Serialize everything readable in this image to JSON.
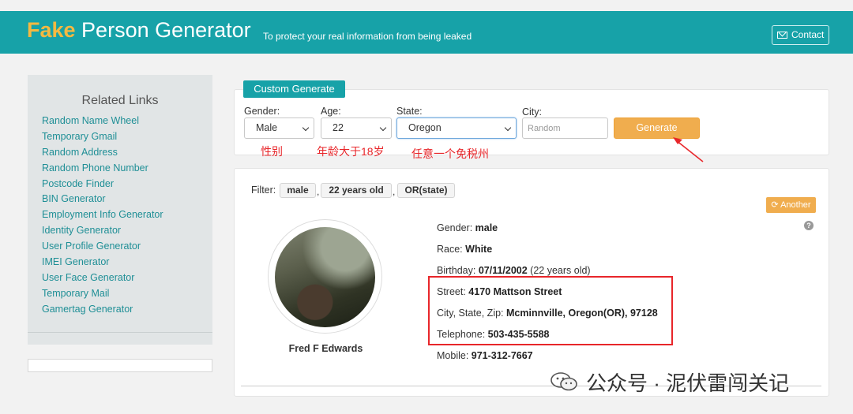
{
  "header": {
    "title_fake": "Fake",
    "title_rest": " Person Generator",
    "tagline": "To protect your real information from being leaked",
    "contact_label": "Contact"
  },
  "sidebar": {
    "heading": "Related Links",
    "items": [
      "Random Name Wheel",
      "Temporary Gmail",
      "Random Address",
      "Random Phone Number",
      "Postcode Finder",
      "BIN Generator",
      "Employment Info Generator",
      "Identity Generator",
      "User Profile Generator",
      "IMEI Generator",
      "User Face Generator",
      "Temporary Mail",
      "Gamertag Generator"
    ]
  },
  "custom": {
    "tab_label": "Custom Generate",
    "gender_label": "Gender:",
    "gender_value": "Male",
    "age_label": "Age:",
    "age_value": "22",
    "state_label": "State:",
    "state_value": "Oregon",
    "city_label": "City:",
    "city_placeholder": "Random",
    "generate_label": "Generate",
    "note_gender": "性别",
    "note_age": "年龄大于18岁",
    "note_state": "任意一个免税州"
  },
  "result": {
    "filter_label": "Filter:",
    "filters": [
      "male",
      "22 years old",
      "OR(state)"
    ],
    "another_label": "Another",
    "name": "Fred F Edwards",
    "fields": [
      {
        "label": "Gender: ",
        "value": "male",
        "suffix": ""
      },
      {
        "label": "Race: ",
        "value": "White",
        "suffix": ""
      },
      {
        "label": "Birthday: ",
        "value": "07/11/2002",
        "suffix": " (22 years old)"
      },
      {
        "label": "Street: ",
        "value": "4170 Mattson Street",
        "suffix": ""
      },
      {
        "label": "City, State, Zip: ",
        "value": "Mcminnville, Oregon(OR), 97128",
        "suffix": ""
      },
      {
        "label": "Telephone: ",
        "value": "503-435-5588",
        "suffix": ""
      },
      {
        "label": "Mobile: ",
        "value": "971-312-7667",
        "suffix": ""
      }
    ]
  },
  "watermark": "公众号 · 泥伏雷闯关记",
  "colors": {
    "brand": "#17a2a8",
    "accent": "#f0ad4e",
    "annotation": "#e8262a",
    "link": "#1f8f96"
  }
}
